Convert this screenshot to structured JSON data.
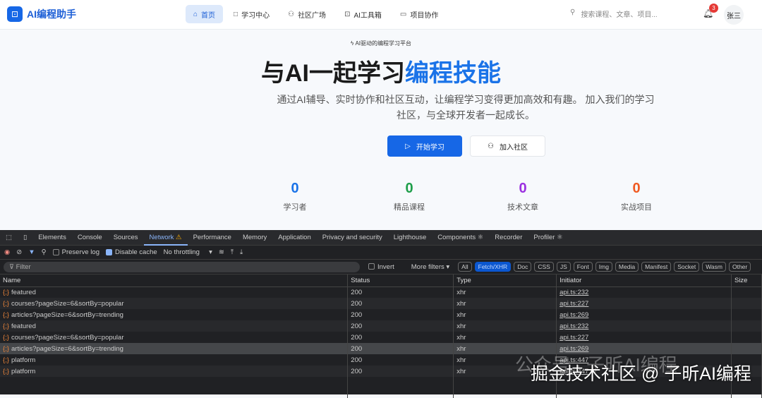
{
  "nav": {
    "logo": "AI编程助手",
    "items": [
      {
        "icon": "home-icon",
        "glyph": "⌂",
        "label": "首页"
      },
      {
        "icon": "book-icon",
        "glyph": "□",
        "label": "学习中心"
      },
      {
        "icon": "users-icon",
        "glyph": "⚇",
        "label": "社区广场"
      },
      {
        "icon": "robot-icon",
        "glyph": "⊡",
        "label": "AI工具箱"
      },
      {
        "icon": "folder-icon",
        "glyph": "▭",
        "label": "项目协作"
      }
    ],
    "search_placeholder": "搜索课程、文章、项目...",
    "notification_count": "3",
    "user": "张三"
  },
  "hero": {
    "tag": "AI驱动的编程学习平台",
    "title_main": "与AI一起学习",
    "title_highlight": "编程技能",
    "desc": "通过AI辅导、实时协作和社区互动，让编程学习变得更加高效和有趣。 加入我们的学习社区，与全球开发者一起成长。",
    "start": "开始学习",
    "join": "加入社区"
  },
  "stats": [
    {
      "value": "0",
      "label": "学习者",
      "color": "#1a73e8"
    },
    {
      "value": "0",
      "label": "精品课程",
      "color": "#1e9e4a"
    },
    {
      "value": "0",
      "label": "技术文章",
      "color": "#9b30e0"
    },
    {
      "value": "0",
      "label": "实战项目",
      "color": "#f05a22"
    }
  ],
  "devtools": {
    "tabs": [
      "Elements",
      "Console",
      "Sources",
      "Network",
      "Performance",
      "Memory",
      "Application",
      "Privacy and security",
      "Lighthouse",
      "Components",
      "Recorder",
      "Profiler"
    ],
    "preserve_log": "Preserve log",
    "disable_cache": "Disable cache",
    "throttling": "No throttling",
    "filter_placeholder": "Filter",
    "invert": "Invert",
    "more_filters": "More filters",
    "type_filters": [
      "All",
      "Fetch/XHR",
      "Doc",
      "CSS",
      "JS",
      "Font",
      "Img",
      "Media",
      "Manifest",
      "Socket",
      "Wasm",
      "Other"
    ],
    "columns": [
      "Name",
      "Status",
      "Type",
      "Initiator",
      "Size"
    ],
    "rows": [
      {
        "name": "featured",
        "status": "200",
        "type": "xhr",
        "initiator": "api.ts:232"
      },
      {
        "name": "courses?pageSize=6&sortBy=popular",
        "status": "200",
        "type": "xhr",
        "initiator": "api.ts:227"
      },
      {
        "name": "articles?pageSize=6&sortBy=trending",
        "status": "200",
        "type": "xhr",
        "initiator": "api.ts:269"
      },
      {
        "name": "featured",
        "status": "200",
        "type": "xhr",
        "initiator": "api.ts:232"
      },
      {
        "name": "courses?pageSize=6&sortBy=popular",
        "status": "200",
        "type": "xhr",
        "initiator": "api.ts:227"
      },
      {
        "name": "articles?pageSize=6&sortBy=trending",
        "status": "200",
        "type": "xhr",
        "initiator": "api.ts:269"
      },
      {
        "name": "platform",
        "status": "200",
        "type": "xhr",
        "initiator": "api.ts:447"
      },
      {
        "name": "platform",
        "status": "200",
        "type": "xhr",
        "initiator": "api.ts:447"
      }
    ]
  },
  "watermark": {
    "line1": "公众号 · 子昕AI编程",
    "line2": "掘金技术社区 @ 子昕AI编程"
  }
}
